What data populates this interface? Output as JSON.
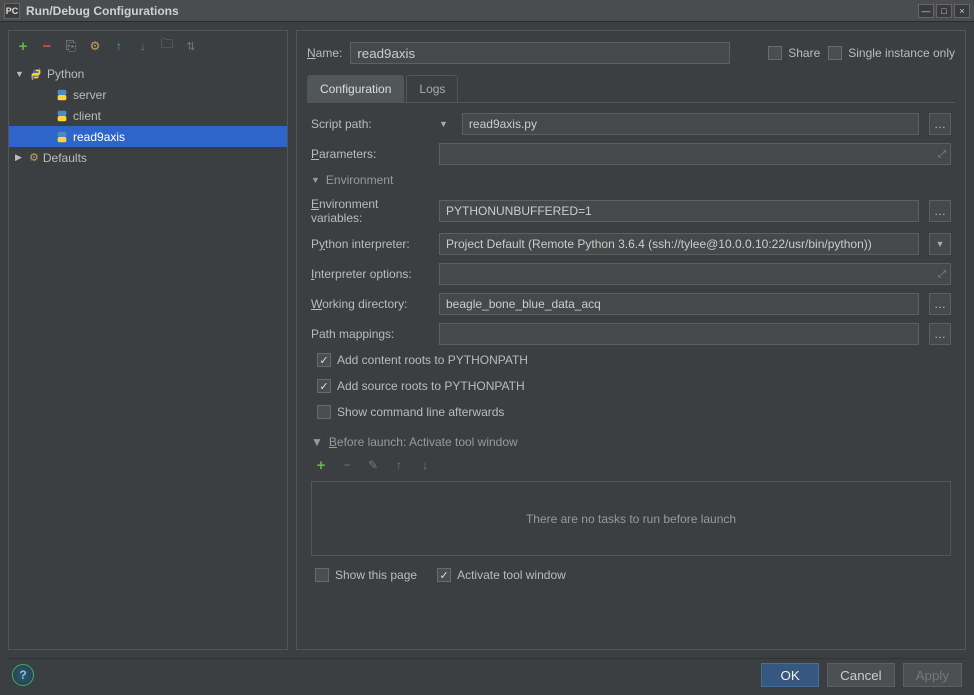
{
  "window": {
    "title": "Run/Debug Configurations"
  },
  "sidebar": {
    "python_label": "Python",
    "defaults_label": "Defaults",
    "items": [
      "server",
      "client",
      "read9axis"
    ],
    "selected_index": 2
  },
  "form": {
    "name_label": "Name:",
    "name_value": "read9axis",
    "share_label": "Share",
    "single_instance_label": "Single instance only",
    "tab_config": "Configuration",
    "tab_logs": "Logs",
    "script_path_label": "Script path:",
    "script_path_value": "read9axis.py",
    "parameters_label": "Parameters:",
    "parameters_value": "",
    "env_section": "Environment",
    "env_vars_label": "Environment variables:",
    "env_vars_value": "PYTHONUNBUFFERED=1",
    "interpreter_label": "Python interpreter:",
    "interpreter_value": "Project Default (Remote Python 3.6.4 (ssh://tylee@10.0.0.10:22/usr/bin/python))",
    "interp_opts_label": "Interpreter options:",
    "interp_opts_value": "",
    "workdir_label": "Working directory:",
    "workdir_value": "beagle_bone_blue_data_acq",
    "path_map_label": "Path mappings:",
    "path_map_value": "",
    "chk_content_roots": "Add content roots to PYTHONPATH",
    "chk_source_roots": "Add source roots to PYTHONPATH",
    "chk_show_cmd": "Show command line afterwards",
    "before_launch_label": "Before launch: Activate tool window",
    "no_tasks": "There are no tasks to run before launch",
    "chk_show_page": "Show this page",
    "chk_activate_tool": "Activate tool window"
  },
  "footer": {
    "ok": "OK",
    "cancel": "Cancel",
    "apply": "Apply"
  }
}
